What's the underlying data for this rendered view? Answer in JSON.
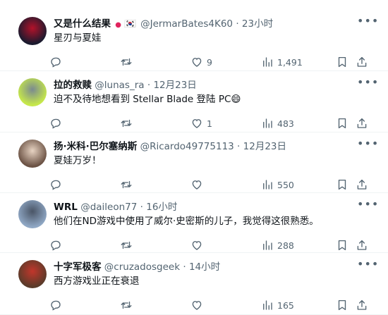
{
  "tweets": [
    {
      "name": "又是什么结果",
      "badges": [
        "●",
        "🇰🇷"
      ],
      "handle": "@JermarBates4K60",
      "sep": "·",
      "time": "23小时",
      "text": "星刃与夏娃",
      "likes": "9",
      "views": "1,491",
      "avatar_colors": [
        "#1a1a2e",
        "#b3122a"
      ]
    },
    {
      "name": "拉的救赎",
      "handle": "@lunas_ra",
      "sep": "·",
      "time": "12月23日",
      "text": "迫不及待地想看到 Stellar Blade 登陆 PC😄",
      "likes": "1",
      "views": "483",
      "avatar_colors": [
        "#c6e84a",
        "#7a8a90"
      ]
    },
    {
      "name": "扬·米科·巴尔塞纳斯",
      "handle": "@Ricardo49775113",
      "sep": "·",
      "time": "12月23日",
      "text": "夏娃万岁！",
      "likes": "",
      "views": "550",
      "avatar_colors": [
        "#6b5244",
        "#e7d3c2"
      ]
    },
    {
      "name": "WRL",
      "handle": "@daileon77",
      "sep": "·",
      "time": "16小时",
      "text": "他们在ND游戏中使用了威尔·史密斯的儿子，我觉得这很熟悉。",
      "likes": "",
      "views": "288",
      "avatar_colors": [
        "#8fa7c4",
        "#4a5566"
      ]
    },
    {
      "name": "十字军极客",
      "handle": "@cruzadosgeek",
      "sep": "·",
      "time": "14小时",
      "text": "西方游戏业正在衰退",
      "likes": "",
      "views": "165",
      "avatar_colors": [
        "#5a3b2a",
        "#c2362b"
      ]
    }
  ],
  "colors": {
    "muted": "#536471",
    "text": "#0f1419",
    "divider": "#eff3f4"
  },
  "icons": [
    "more-icon",
    "reply-icon",
    "retweet-icon",
    "like-icon",
    "views-icon",
    "bookmark-icon",
    "share-icon"
  ]
}
